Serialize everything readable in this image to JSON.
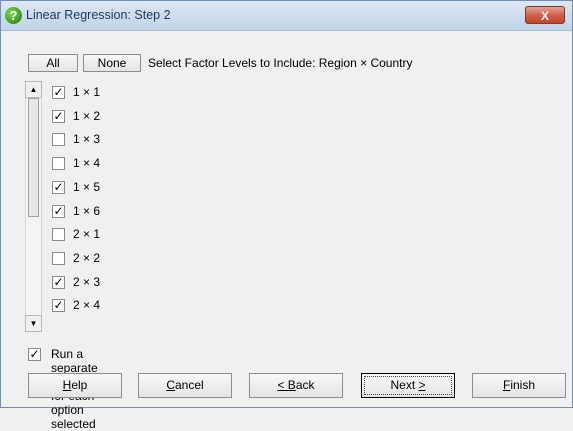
{
  "window": {
    "title": "Linear Regression: Step 2",
    "close_label": "X"
  },
  "toolbar": {
    "all_label": "All",
    "none_label": "None",
    "header_text": "Select Factor Levels to Include: Region × Country"
  },
  "levels": [
    {
      "label": "1 × 1",
      "checked": true
    },
    {
      "label": "1 × 2",
      "checked": true
    },
    {
      "label": "1 × 3",
      "checked": false
    },
    {
      "label": "1 × 4",
      "checked": false
    },
    {
      "label": "1 × 5",
      "checked": true
    },
    {
      "label": "1 × 6",
      "checked": true
    },
    {
      "label": "2 × 1",
      "checked": false
    },
    {
      "label": "2 × 2",
      "checked": false
    },
    {
      "label": "2 × 3",
      "checked": true
    },
    {
      "label": "2 × 4",
      "checked": true
    }
  ],
  "separate_analysis": {
    "label": "Run a separate analysis for each option selected",
    "checked": true
  },
  "buttons": {
    "help": {
      "pre": "",
      "u": "H",
      "post": "elp"
    },
    "cancel": {
      "pre": "",
      "u": "C",
      "post": "ancel"
    },
    "back": {
      "pre": "",
      "u": "< B",
      "post": "ack"
    },
    "next": {
      "pre": "Next ",
      "u": ">",
      "post": ""
    },
    "finish": {
      "pre": "",
      "u": "F",
      "post": "inish"
    }
  }
}
